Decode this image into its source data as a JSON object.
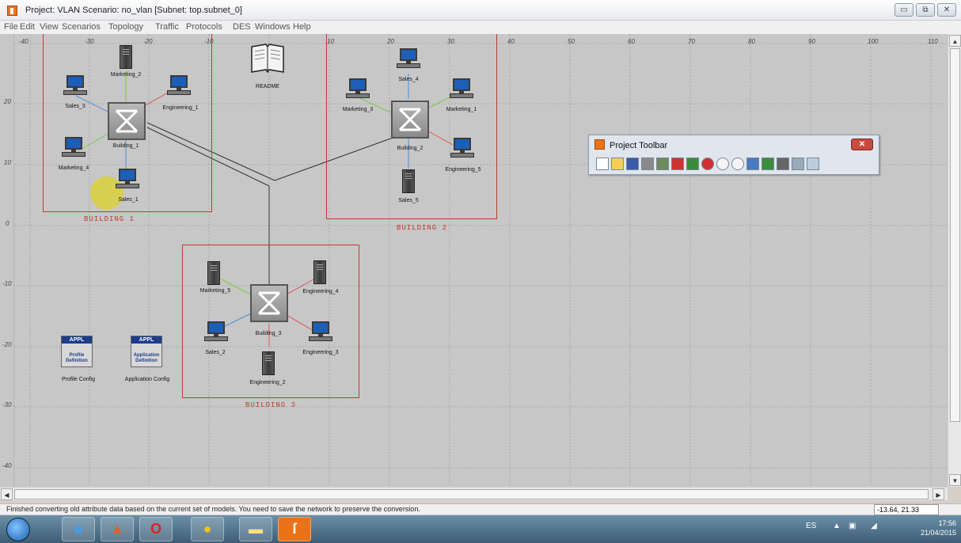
{
  "window": {
    "title": "Project: VLAN Scenario: no_vlan  [Subnet: top.subnet_0]",
    "controls": [
      "minimize",
      "maximize",
      "close"
    ]
  },
  "menu": [
    "File",
    "Edit",
    "View",
    "Scenarios",
    "Topology",
    "Traffic",
    "Protocols",
    "DES",
    "Windows",
    "Help"
  ],
  "ruler": {
    "x_labels": [
      "-40",
      "-30",
      "-20",
      "-10",
      "10",
      "20",
      "30",
      "40",
      "50",
      "60",
      "70",
      "80",
      "90",
      "100",
      "110"
    ],
    "y_labels": [
      "20",
      "10",
      "0",
      "-10",
      "-20",
      "-30",
      "-40"
    ]
  },
  "buildings": {
    "b1": "BUILDING 1",
    "b2": "BUILDING 2",
    "b3": "BUILDING 3"
  },
  "nodes": {
    "marketing_2": "Marketing_2",
    "sales_3": "Sales_3",
    "engineering_1": "Engineering_1",
    "building_1": "Building_1",
    "marketing_4": "Marketing_4",
    "sales_1": "Sales_1",
    "readme": "README",
    "sales_4": "Sales_4",
    "marketing_3": "Marketing_3",
    "marketing_1": "Marketing_1",
    "building_2": "Building_2",
    "engineering_5": "Engineering_5",
    "sales_5": "Sales_5",
    "marketing_5": "Marketing_5",
    "engineering_4": "Engineering_4",
    "building_3": "Building_3",
    "sales_2": "Sales_2",
    "engineering_3": "Engineering_3",
    "engineering_2": "Engineering_2",
    "profile_config": "Profile Config",
    "application_config": "Application Config",
    "appl_badge": "APPL",
    "profile_def": "Profile Definition",
    "application_def": "Application Definition"
  },
  "project_toolbar": {
    "title": "Project Toolbar",
    "close": "✕",
    "tools": [
      "new-icon",
      "open-icon",
      "save-icon",
      "print-icon",
      "object-palette-icon",
      "failure-icon",
      "recover-icon",
      "return-to-parent-icon",
      "zoom-in-icon",
      "zoom-out-icon",
      "configure-des-icon",
      "view-results-icon",
      "hide-results-icon",
      "hide-graphs-icon",
      "edit-graphs-icon"
    ]
  },
  "status": {
    "message": "Finished converting old attribute data based on the current set of models.  You need to save the network to preserve the conversion.",
    "coords": "-13.64, 21.33"
  },
  "taskbar": {
    "apps": [
      "internet-explorer",
      "matlab",
      "opera",
      "chrome",
      "file-explorer",
      "riverbed-modeler"
    ],
    "lang": "ES",
    "time": "17:56",
    "date": "21/04/2015"
  }
}
